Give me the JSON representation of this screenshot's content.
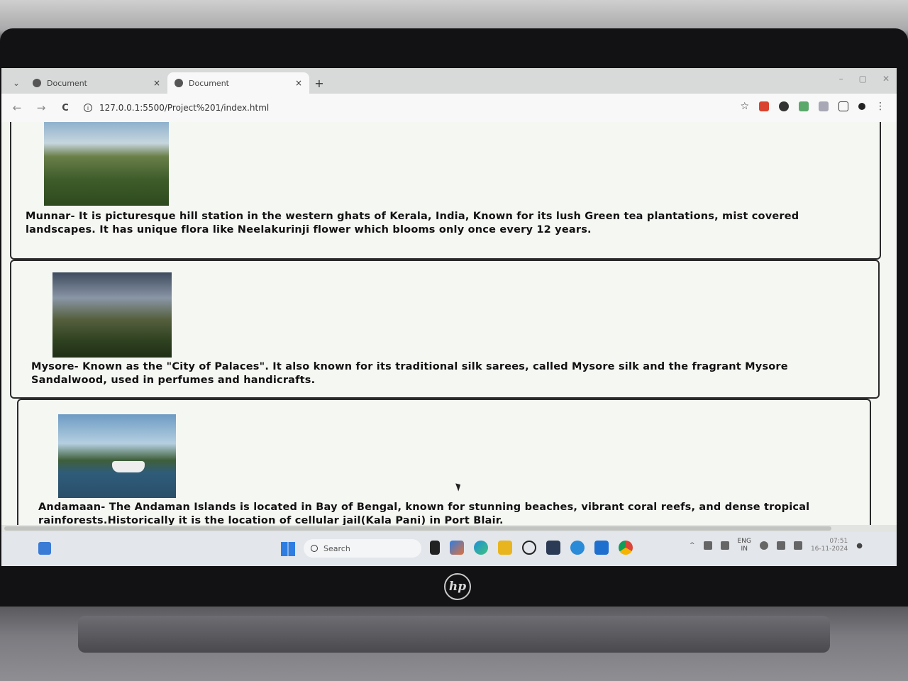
{
  "browser": {
    "tabs": [
      {
        "title": "Document",
        "close": "×"
      },
      {
        "title": "Document",
        "close": "×"
      }
    ],
    "new_tab": "+",
    "url": "127.0.0.1:5500/Project%201/index.html",
    "nav": {
      "back": "←",
      "forward": "→",
      "reload": "C"
    },
    "bookmark_star": "☆",
    "window_controls": [
      "–",
      "▢",
      "✕"
    ]
  },
  "page": {
    "cards": [
      {
        "place": "Munnar",
        "image_alt": "Munnar hills with mist",
        "caption": "Munnar- It is picturesque hill station in the western ghats of Kerala, India, Known for its lush Green tea plantations, mist covered landscapes. It has unique flora like Neelakurinji flower which blooms only once every 12 years."
      },
      {
        "place": "Mysore",
        "image_alt": "Mysore green hills under clouds",
        "caption": "Mysore- Known as the \"City of Palaces\". It also known for its traditional silk sarees, called Mysore silk and the fragrant Mysore Sandalwood, used in perfumes and handicrafts."
      },
      {
        "place": "Andamaan",
        "image_alt": "Boat near an Andaman island",
        "caption": "Andamaan- The Andaman Islands is located in Bay of Bengal, known for stunning beaches, vibrant coral reefs, and dense tropical rainforests.Historically it is the location of cellular jail(Kala Pani) in Port Blair."
      }
    ]
  },
  "taskbar": {
    "search_placeholder": "Search",
    "apps": [
      "file-explorer-icon",
      "copilot-icon",
      "edge-icon",
      "folder-icon",
      "whatsapp-icon",
      "store-icon",
      "telegram-icon",
      "vscode-icon",
      "chrome-icon"
    ],
    "lang_line1": "ENG",
    "lang_line2": "IN",
    "time": "07:51",
    "date": "16-11-2024"
  },
  "laptop_logo": "hp",
  "colors": {
    "accent_blue": "#2f7de1",
    "screen_bg": "#f4f6f2",
    "card_border": "#2a2a2a"
  }
}
